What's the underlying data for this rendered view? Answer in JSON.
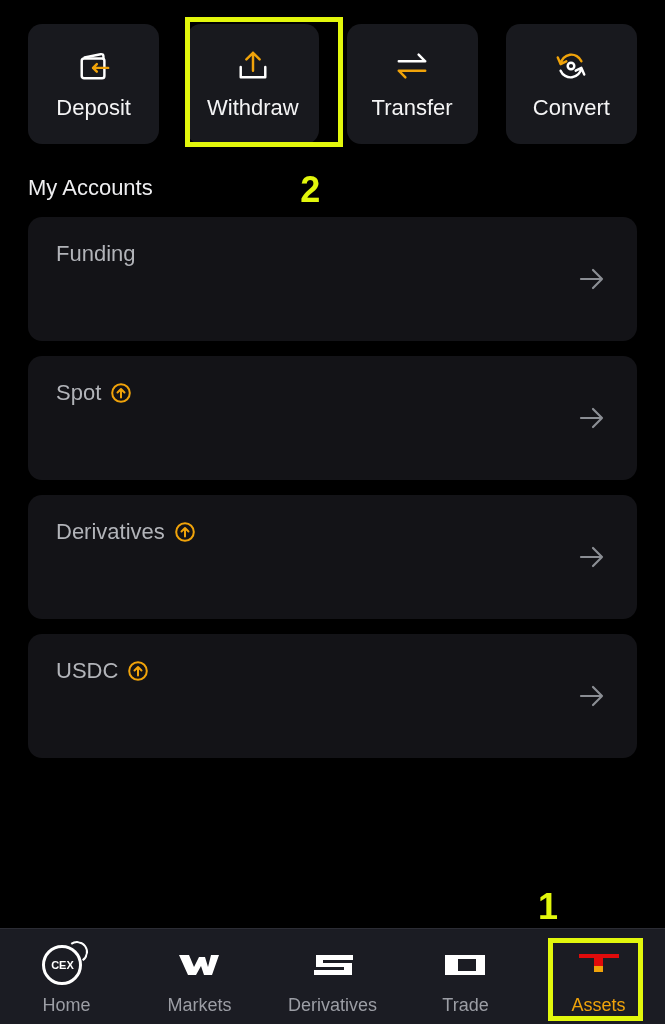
{
  "actions": [
    {
      "label": "Deposit",
      "highlighted": false
    },
    {
      "label": "Withdraw",
      "highlighted": true,
      "callout": "2"
    },
    {
      "label": "Transfer",
      "highlighted": false
    },
    {
      "label": "Convert",
      "highlighted": false
    }
  ],
  "section_title": "My Accounts",
  "accounts": [
    {
      "name": "Funding",
      "upgrade_badge": false
    },
    {
      "name": "Spot",
      "upgrade_badge": true
    },
    {
      "name": "Derivatives",
      "upgrade_badge": true
    },
    {
      "name": "USDC",
      "upgrade_badge": true
    }
  ],
  "bottom_nav": [
    {
      "label": "Home",
      "icon_text": "CEX",
      "selected": false,
      "highlighted": false
    },
    {
      "label": "Markets",
      "selected": false,
      "highlighted": false
    },
    {
      "label": "Derivatives",
      "selected": false,
      "highlighted": false
    },
    {
      "label": "Trade",
      "selected": false,
      "highlighted": false
    },
    {
      "label": "Assets",
      "selected": true,
      "highlighted": true,
      "callout": "1"
    }
  ]
}
